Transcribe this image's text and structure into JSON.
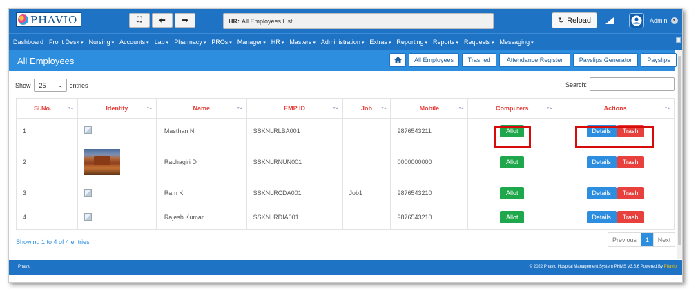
{
  "header": {
    "logo_text": "PHAVIO",
    "title_prefix": "HR:",
    "title_text": "All Employees List",
    "reload_label": "Reload",
    "user_label": "Admin"
  },
  "menu": [
    {
      "label": "Dashboard",
      "dropdown": false
    },
    {
      "label": "Front Desk",
      "dropdown": true
    },
    {
      "label": "Nursing",
      "dropdown": true
    },
    {
      "label": "Accounts",
      "dropdown": true
    },
    {
      "label": "Lab",
      "dropdown": true
    },
    {
      "label": "Pharmacy",
      "dropdown": true
    },
    {
      "label": "PROs",
      "dropdown": true
    },
    {
      "label": "Manager",
      "dropdown": true
    },
    {
      "label": "HR",
      "dropdown": true
    },
    {
      "label": "Masters",
      "dropdown": true
    },
    {
      "label": "Administration",
      "dropdown": true
    },
    {
      "label": "Extras",
      "dropdown": true
    },
    {
      "label": "Reporting",
      "dropdown": true
    },
    {
      "label": "Reports",
      "dropdown": true
    },
    {
      "label": "Requests",
      "dropdown": true
    },
    {
      "label": "Messaging",
      "dropdown": true
    }
  ],
  "page": {
    "title": "All Employees",
    "buttons": [
      "All Employees",
      "Trashed",
      "Attendance Register",
      "Payslips Generator",
      "Payslips"
    ]
  },
  "table_controls": {
    "show_label": "Show",
    "entries_value": "25",
    "entries_label": "entries",
    "search_label": "Search:",
    "search_value": ""
  },
  "table": {
    "headers": [
      "Sl.No.",
      "Identity",
      "Name",
      "EMP ID",
      "Job",
      "Mobile",
      "Computers",
      "Actions"
    ],
    "rows": [
      {
        "sl": "1",
        "identity": "broken",
        "name": "Masthan N",
        "emp_id": "SSKNLRLBA001",
        "job": "",
        "mobile": "9876543211",
        "computers": "Allot",
        "details": "Details",
        "trash": "Trash"
      },
      {
        "sl": "2",
        "identity": "photo",
        "name": "Rachagiri D",
        "emp_id": "SSKNLRNUN001",
        "job": "",
        "mobile": "0000000000",
        "computers": "Allot",
        "details": "Details",
        "trash": "Trash"
      },
      {
        "sl": "3",
        "identity": "broken",
        "name": "Ram K",
        "emp_id": "SSKNLRCDA001",
        "job": "Job1",
        "mobile": "9876543210",
        "computers": "Allot",
        "details": "Details",
        "trash": "Trash"
      },
      {
        "sl": "4",
        "identity": "broken",
        "name": "Rajesh Kumar",
        "emp_id": "SSKNLRDIA001",
        "job": "",
        "mobile": "9876543210",
        "computers": "Allot",
        "details": "Details",
        "trash": "Trash"
      }
    ]
  },
  "pagination": {
    "info": "Showing 1 to 4 of 4 entries",
    "prev_label": "Previous",
    "current_page": "1",
    "next_label": "Next"
  },
  "footer": {
    "left": "Phavio",
    "right_prefix": "© 2022 Phavio Hospital Management System PHMS V3.5.6 Powered By ",
    "right_brand": "Phavio"
  },
  "colors": {
    "primary": "#1f73c4",
    "page_head": "#2d8ee0",
    "allot": "#1fa84b",
    "trash": "#e8413d",
    "header_text": "#e8413d",
    "highlight": "#d80b0b"
  }
}
